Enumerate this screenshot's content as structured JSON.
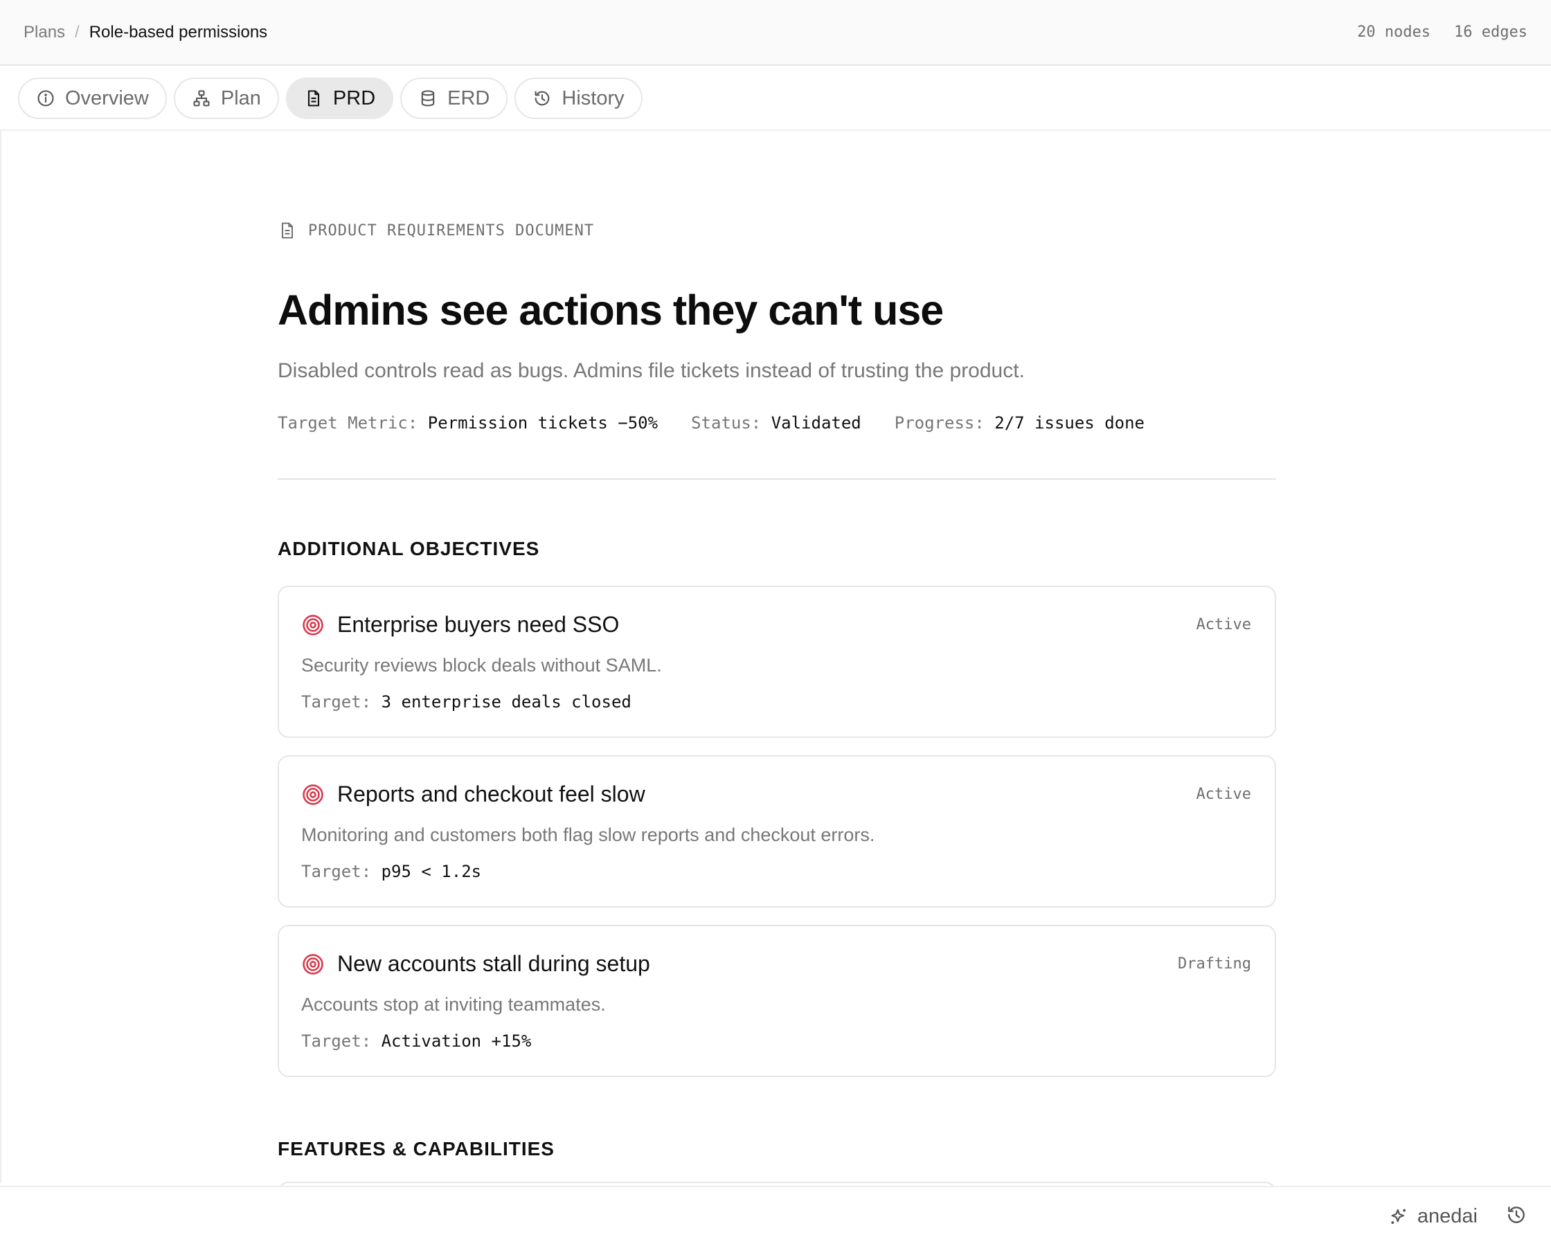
{
  "breadcrumb": {
    "root": "Plans",
    "separator": "/",
    "current": "Role-based permissions"
  },
  "counts": {
    "nodes": "20 nodes",
    "edges": "16 edges"
  },
  "tabs": [
    {
      "label": "Overview",
      "icon": "info-icon"
    },
    {
      "label": "Plan",
      "icon": "hierarchy-icon"
    },
    {
      "label": "PRD",
      "icon": "document-icon",
      "active": true
    },
    {
      "label": "ERD",
      "icon": "database-icon"
    },
    {
      "label": "History",
      "icon": "history-icon"
    }
  ],
  "doc": {
    "label": "PRODUCT REQUIREMENTS DOCUMENT",
    "title": "Admins see actions they can't use",
    "subtitle": "Disabled controls read as bugs. Admins file tickets instead of trusting the product.",
    "meta": {
      "target_metric_label": "Target Metric:",
      "target_metric_value": "Permission tickets −50%",
      "status_label": "Status:",
      "status_value": "Validated",
      "progress_label": "Progress:",
      "progress_value": "2/7 issues done"
    }
  },
  "sections": {
    "objectives_title": "ADDITIONAL OBJECTIVES",
    "features_title": "FEATURES & CAPABILITIES"
  },
  "objectives": [
    {
      "title": "Enterprise buyers need SSO",
      "status": "Active",
      "description": "Security reviews block deals without SAML.",
      "target_label": "Target:",
      "target_value": "3 enterprise deals closed"
    },
    {
      "title": "Reports and checkout feel slow",
      "status": "Active",
      "description": "Monitoring and customers both flag slow reports and checkout errors.",
      "target_label": "Target:",
      "target_value": "p95 < 1.2s"
    },
    {
      "title": "New accounts stall during setup",
      "status": "Drafting",
      "description": "Accounts stop at inviting teammates.",
      "target_label": "Target:",
      "target_value": "Activation +15%"
    }
  ],
  "footer": {
    "brand": "anedai"
  },
  "colors": {
    "accent_red": "#d9364a",
    "active_tab_bg": "#e9e9e9"
  }
}
